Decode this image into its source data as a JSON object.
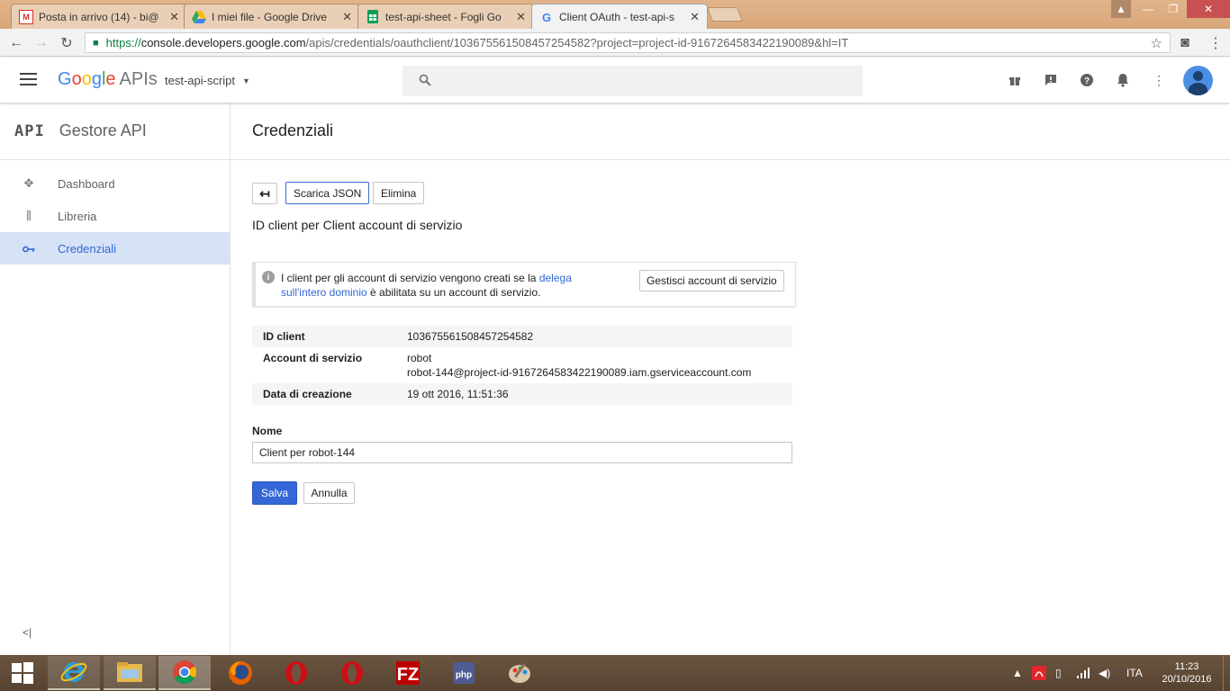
{
  "browser": {
    "tabs": [
      {
        "title": "Posta in arrivo (14) - bi@",
        "favicon": "M",
        "badge": "14"
      },
      {
        "title": "I miei file - Google Drive",
        "favicon": "drive"
      },
      {
        "title": "test-api-sheet - Fogli Go",
        "favicon": "sheets"
      },
      {
        "title": "Client OAuth - test-api-s",
        "favicon": "G"
      }
    ],
    "url_scheme": "https://",
    "url_host": "console.developers.google.com",
    "url_path": "/apis/credentials/oauthclient/103675561508457254582?project=project-id-9167264583422190089&hl=IT"
  },
  "header": {
    "logo_text": "Google",
    "logo_apis": "APIs",
    "project": "test-api-script"
  },
  "sidebar": {
    "api_mark": "API",
    "title": "Gestore API",
    "items": [
      {
        "label": "Dashboard",
        "icon": "dashboard-icon"
      },
      {
        "label": "Libreria",
        "icon": "library-icon"
      },
      {
        "label": "Credenziali",
        "icon": "key-icon",
        "active": true
      }
    ],
    "collapse": "<|"
  },
  "main": {
    "title": "Credenziali",
    "download_label": "Scarica JSON",
    "delete_label": "Elimina",
    "subtitle": "ID client per Client account di servizio",
    "info": {
      "text_before": "I client per gli account di servizio vengono creati se la ",
      "link": "delega sull'intero dominio",
      "text_after": " è abilitata su un account di servizio.",
      "button": "Gestisci account di servizio"
    },
    "details": {
      "client_id_label": "ID client",
      "client_id": "103675561508457254582",
      "service_account_label": "Account di servizio",
      "service_account_name": "robot",
      "service_account_email": "robot-144@project-id-9167264583422190089.iam.gserviceaccount.com",
      "created_label": "Data di creazione",
      "created": "19 ott 2016, 11:51:36"
    },
    "name_label": "Nome",
    "name_value": "Client per robot-144",
    "save_label": "Salva",
    "cancel_label": "Annulla"
  },
  "taskbar": {
    "language": "ITA",
    "time": "11:23",
    "date": "20/10/2016"
  },
  "colors": {
    "accent": "#3367d6",
    "active_nav_bg": "#d6e3f6"
  }
}
